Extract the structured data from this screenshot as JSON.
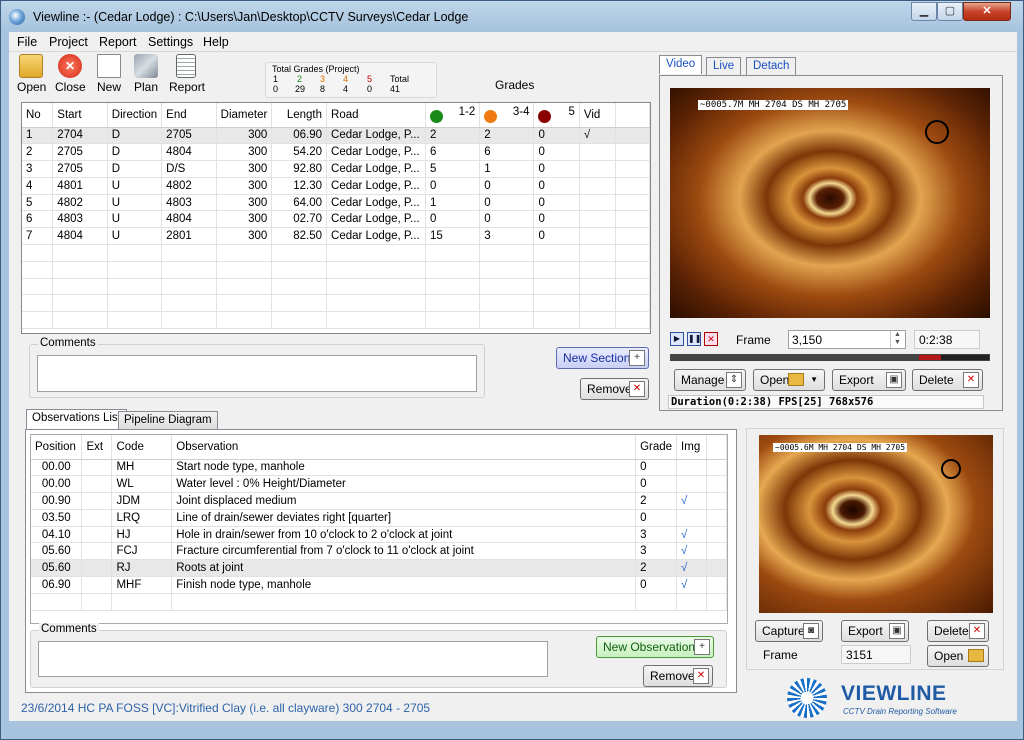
{
  "window": {
    "title": "Viewline :- (Cedar Lodge) : C:\\Users\\Jan\\Desktop\\CCTV Surveys\\Cedar Lodge",
    "minimize": "▁",
    "maximize": "▢",
    "close": "✕"
  },
  "menu": [
    "File",
    "Project",
    "Report",
    "Settings",
    "Help"
  ],
  "toolbar": [
    {
      "label": "Open",
      "icon": "open-folder-icon"
    },
    {
      "label": "Close",
      "icon": "close-circle-icon"
    },
    {
      "label": "New",
      "icon": "new-document-icon"
    },
    {
      "label": "Plan",
      "icon": "plan-icon"
    },
    {
      "label": "Report",
      "icon": "report-icon"
    }
  ],
  "total_grades": {
    "title": "Total Grades (Project)",
    "headers": [
      "1",
      "2",
      "3",
      "4",
      "5",
      "Total"
    ],
    "values": [
      "0",
      "29",
      "8",
      "4",
      "0",
      "41"
    ],
    "header_colors": [
      "#000000",
      "#1a8a1a",
      "#e07000",
      "#e07000",
      "#c00000",
      "#000000"
    ]
  },
  "grades_label": "Grades",
  "sections": {
    "headers": [
      "No",
      "Start",
      "Direction",
      "End",
      "Diameter",
      "Length",
      "Road",
      "1-2",
      "3-4",
      "5",
      "Vid"
    ],
    "rows": [
      [
        "1",
        "2704",
        "D",
        "2705",
        "300",
        "06.90",
        "Cedar Lodge, P...",
        "2",
        "2",
        "0",
        "√"
      ],
      [
        "2",
        "2705",
        "D",
        "4804",
        "300",
        "54.20",
        "Cedar Lodge, P...",
        "6",
        "6",
        "0",
        ""
      ],
      [
        "3",
        "2705",
        "D",
        "D/S",
        "300",
        "92.80",
        "Cedar Lodge, P...",
        "5",
        "1",
        "0",
        ""
      ],
      [
        "4",
        "4801",
        "U",
        "4802",
        "300",
        "12.30",
        "Cedar Lodge, P...",
        "0",
        "0",
        "0",
        ""
      ],
      [
        "5",
        "4802",
        "U",
        "4803",
        "300",
        "64.00",
        "Cedar Lodge, P...",
        "1",
        "0",
        "0",
        ""
      ],
      [
        "6",
        "4803",
        "U",
        "4804",
        "300",
        "02.70",
        "Cedar Lodge, P...",
        "0",
        "0",
        "0",
        ""
      ],
      [
        "7",
        "4804",
        "U",
        "2801",
        "300",
        "82.50",
        "Cedar Lodge, P...",
        "15",
        "3",
        "0",
        ""
      ]
    ]
  },
  "section_comments": {
    "label": "Comments",
    "value": ""
  },
  "buttons": {
    "new_section": "New Section",
    "remove_section": "Remove",
    "new_observation": "New Observation",
    "remove_observation": "Remove"
  },
  "tabs": [
    "Observations List",
    "Pipeline Diagram"
  ],
  "observations": {
    "headers": [
      "Position",
      "Ext",
      "Code",
      "Observation",
      "Grade",
      "Img"
    ],
    "rows": [
      [
        "00.00",
        "",
        "MH",
        "Start node type, manhole",
        "0",
        ""
      ],
      [
        "00.00",
        "",
        "WL",
        "Water level   : 0% Height/Diameter",
        "0",
        ""
      ],
      [
        "00.90",
        "",
        "JDM",
        "Joint displaced medium",
        "2",
        "√"
      ],
      [
        "03.50",
        "",
        "LRQ",
        "Line of drain/sewer deviates right [quarter]",
        "0",
        ""
      ],
      [
        "04.10",
        "",
        "HJ",
        "Hole in drain/sewer  from 10 o'clock to 2 o'clock at joint",
        "3",
        "√"
      ],
      [
        "05.60",
        "",
        "FCJ",
        "Fracture circumferential  from 7 o'clock to 11 o'clock at joint",
        "3",
        "√"
      ],
      [
        "05.60",
        "",
        "RJ",
        "Roots  at joint",
        "2",
        "√"
      ],
      [
        "06.90",
        "",
        "MHF",
        "Finish node type, manhole",
        "0",
        "√"
      ]
    ]
  },
  "observation_comments": {
    "label": "Comments",
    "value": ""
  },
  "video": {
    "tabs": [
      "Video",
      "Live",
      "Detach"
    ],
    "overlay": "~0005.7M   MH 2704 DS MH 2705",
    "frame_label": "Frame",
    "frame_value": "3,150",
    "time": "0:2:38",
    "buttons": [
      "Manage",
      "Open",
      "Export",
      "Delete"
    ],
    "info": "Duration(0:2:38) FPS[25] 768x576",
    "progress": 0.85
  },
  "capture": {
    "overlay": "~0005.6M   MH 2704 DS MH 2705",
    "buttons": [
      "Capture",
      "Export",
      "Delete",
      "Open"
    ],
    "frame_label": "Frame",
    "frame_value": "3151"
  },
  "status": "23/6/2014  HC  PA FOSS  [VC]:Vitrified Clay (i.e. all clayware) 300 2704 - 2705",
  "logo": {
    "name": "VIEWLINE",
    "tagline": "CCTV Drain Reporting Software"
  }
}
